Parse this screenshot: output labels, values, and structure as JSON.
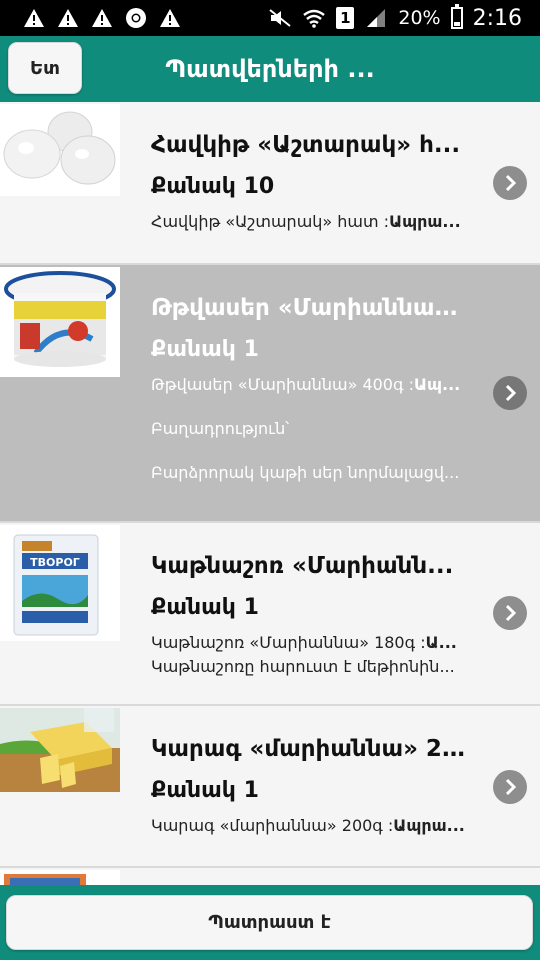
{
  "status_bar": {
    "notification_icons": [
      "warning-icon",
      "warning-icon",
      "warning-icon",
      "chrome-icon",
      "warning-icon"
    ],
    "sim_slot": "1",
    "battery": "20%",
    "time": "2:16"
  },
  "header": {
    "back_label": "Ետ",
    "title": "Պատվերների ..."
  },
  "items": [
    {
      "title": "Հավկիթ «Աշտարակ» հ...",
      "quantity": "Քանակ 10",
      "desc_plain": "Հավկիթ «Աշտարակ» հատ :",
      "desc_bold": "Ապրա..."
    },
    {
      "title": "Թթվասեր «Մարիաննա»...",
      "quantity": "Քանակ 1",
      "desc_plain": "Թթվասեր «Մարիաննա» 400գ :",
      "desc_bold": "Ապ...",
      "line2": "Բաղադրություն՝",
      "line3": "Բարձրորակ կաթի սեր նորմալացվ..."
    },
    {
      "title": "Կաթնաշոռ «Մարիանն...",
      "quantity": "Քանակ 1",
      "desc_plain": "Կաթնաշոռ «Մարիաննա» 180գ :",
      "desc_bold": "Ա...",
      "line2": "Կաթնաշոռը հարուստ է մեթիոնին..."
    },
    {
      "title": "Կարագ «մարիաննա» 20...",
      "quantity": "Քանակ 1",
      "desc_plain": "Կարագ «մարիաննա» 200գ :",
      "desc_bold": "Ապրա..."
    }
  ],
  "footer": {
    "done_label": "Պատրաստ է"
  },
  "colors": {
    "accent": "#0f8c7c",
    "selected_row": "#bdbdbd"
  }
}
